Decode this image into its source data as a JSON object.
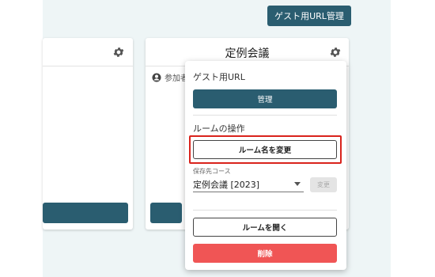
{
  "header": {
    "guest_url_button_label": "ゲスト用URL管理"
  },
  "cards": {
    "middle": {
      "title": "定例会議",
      "participants_label": "参加者"
    }
  },
  "menu": {
    "guest_url_section_title": "ゲスト用URL",
    "manage_button_label": "管理",
    "room_ops_section_title": "ルームの操作",
    "rename_button_label": "ルーム名を変更",
    "save_course_label": "保存先コース",
    "save_course_value": "定例会議 [2023]",
    "change_button_label": "変更",
    "open_room_button_label": "ルームを開く",
    "delete_button_label": "削除"
  },
  "colors": {
    "primary": "#2a5d70",
    "danger": "#f05555",
    "highlight": "#d9231c",
    "background": "#eef5f6"
  },
  "icons": {
    "settings": "gear-icon",
    "participant": "person-circle-icon",
    "dropdown": "caret-down-icon"
  }
}
